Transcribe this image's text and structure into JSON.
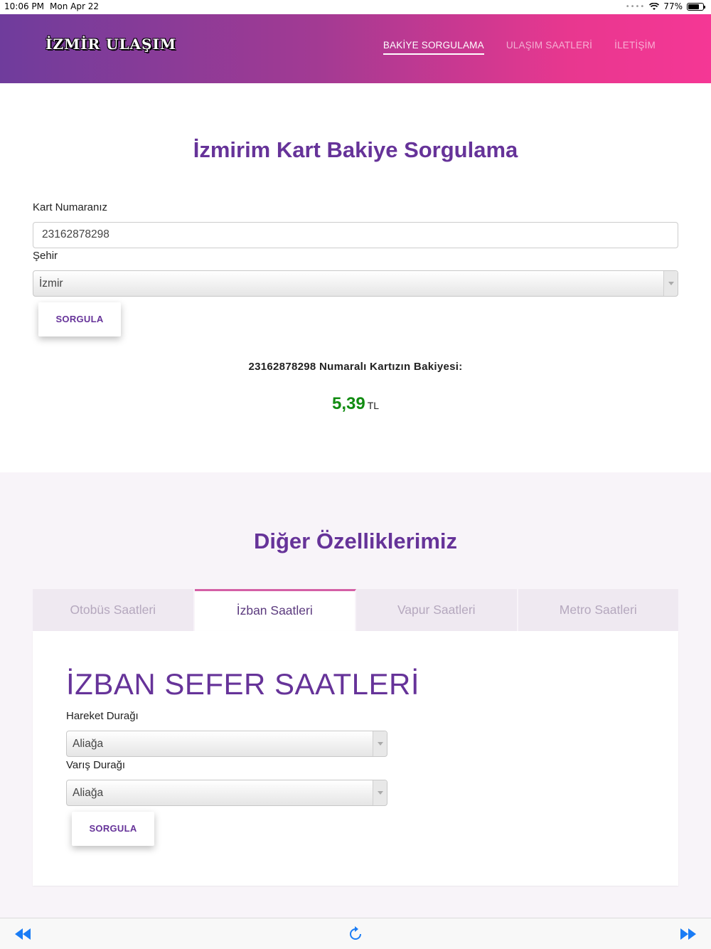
{
  "status_bar": {
    "time": "10:06 PM",
    "date": "Mon Apr 22",
    "battery": "77%",
    "battery_level": 0.77
  },
  "header": {
    "logo": "İZMİR ULAŞIM",
    "nav": [
      {
        "label": "BAKİYE SORGULAMA",
        "active": true
      },
      {
        "label": "ULAŞIM SAATLERİ",
        "active": false
      },
      {
        "label": "İLETİŞİM",
        "active": false
      }
    ]
  },
  "balance_form": {
    "title": "İzmirim Kart Bakiye Sorgulama",
    "card_label": "Kart Numaranız",
    "card_value": "23162878298",
    "city_label": "Şehir",
    "city_value": "İzmir",
    "submit_label": "SORGULA"
  },
  "result": {
    "text": "23162878298 Numaralı Kartızın Bakiyesi:",
    "amount": "5,39",
    "currency": "TL",
    "amount_color": "#128c12"
  },
  "features": {
    "title": "Diğer Özelliklerimiz",
    "tabs": [
      {
        "label": "Otobüs Saatleri",
        "active": false
      },
      {
        "label": "İzban Saatleri",
        "active": true
      },
      {
        "label": "Vapur Saatleri",
        "active": false
      },
      {
        "label": "Metro Saatleri",
        "active": false
      }
    ],
    "panel": {
      "title": "İZBAN SEFER SAATLERİ",
      "from_label": "Hareket Durağı",
      "from_value": "Aliağa",
      "to_label": "Varış Durağı",
      "to_value": "Aliağa",
      "submit_label": "SORGULA"
    }
  },
  "toolbar": {
    "back_icon": "rewind-icon",
    "reload_icon": "reload-icon",
    "forward_icon": "fast-forward-icon"
  },
  "colors": {
    "accent": "#663399",
    "gradient_start": "#6f3c9c",
    "gradient_end": "#f53795"
  }
}
